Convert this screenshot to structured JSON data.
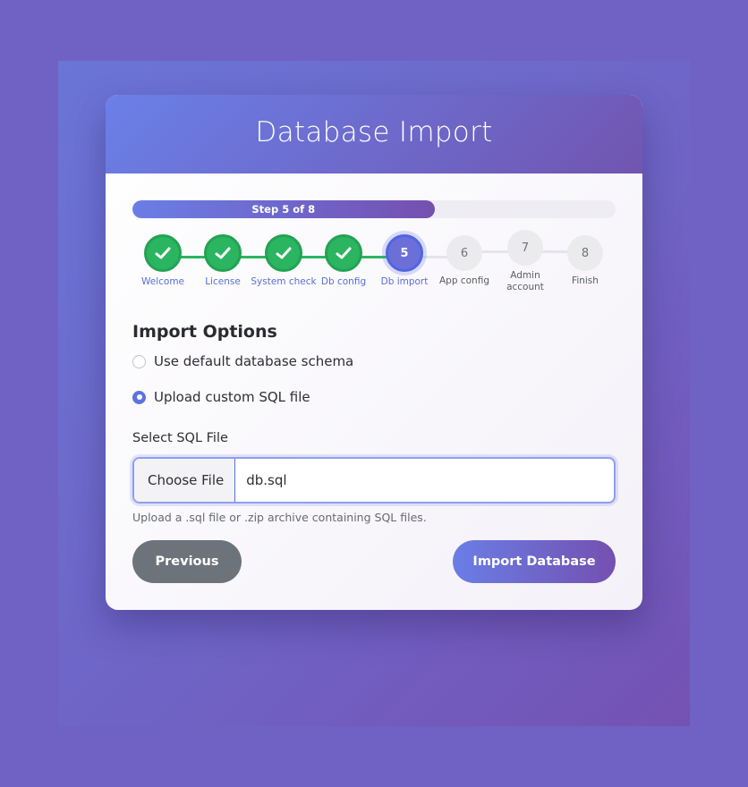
{
  "header": {
    "title": "Database Import"
  },
  "progress": {
    "label": "Step 5 of 8",
    "current": 5,
    "total": 8,
    "fraction": 0.625
  },
  "steps": [
    {
      "number": "1",
      "label": "Welcome",
      "status": "done"
    },
    {
      "number": "2",
      "label": "License",
      "status": "done"
    },
    {
      "number": "3",
      "label": "System check",
      "status": "done"
    },
    {
      "number": "4",
      "label": "Db config",
      "status": "done"
    },
    {
      "number": "5",
      "label": "Db import",
      "status": "active"
    },
    {
      "number": "6",
      "label": "App config",
      "status": "pending"
    },
    {
      "number": "7",
      "label": "Admin account",
      "status": "pending"
    },
    {
      "number": "8",
      "label": "Finish",
      "status": "pending"
    }
  ],
  "import_options": {
    "title": "Import Options",
    "options": [
      {
        "label": "Use default database schema",
        "selected": false
      },
      {
        "label": "Upload custom SQL file",
        "selected": true
      }
    ]
  },
  "file_field": {
    "label": "Select SQL File",
    "button_label": "Choose File",
    "file_name": "db.sql",
    "help": "Upload a .sql file or .zip archive containing SQL files."
  },
  "actions": {
    "previous_label": "Previous",
    "import_label": "Import Database"
  },
  "colors": {
    "accent": "#6a7ee6",
    "accent_end": "#7450b0",
    "done_green": "#2bb561",
    "secondary_button": "#6c737b",
    "background": "#6f62c4"
  }
}
